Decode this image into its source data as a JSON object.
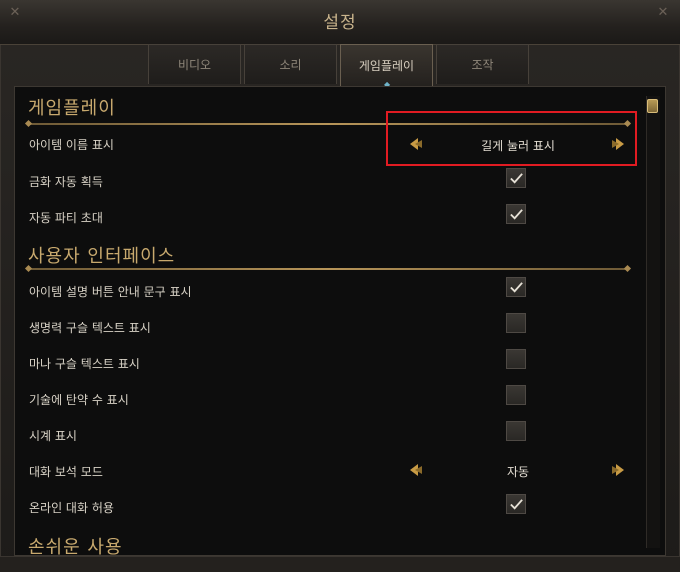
{
  "window": {
    "title": "설정"
  },
  "tabs": [
    {
      "label": "비디오",
      "active": false
    },
    {
      "label": "소리",
      "active": false
    },
    {
      "label": "게임플레이",
      "active": true
    },
    {
      "label": "조작",
      "active": false
    }
  ],
  "sections": {
    "gameplay": "게임플레이",
    "ui": "사용자 인터페이스",
    "accessibility": "손쉬운 사용"
  },
  "settings": {
    "item_name_display": {
      "label": "아이템 이름 표시",
      "value": "길게 눌러 표시"
    },
    "gold_autopickup": {
      "label": "금화 자동 획득",
      "checked": true
    },
    "auto_party_invite": {
      "label": "자동 파티 초대",
      "checked": true
    },
    "item_tooltip_hint": {
      "label": "아이템 설명 버튼 안내 문구 표시",
      "checked": true
    },
    "life_orb_text": {
      "label": "생명력 구슬 텍스트 표시",
      "checked": false
    },
    "mana_orb_text": {
      "label": "마나 구슬 텍스트 표시",
      "checked": false
    },
    "skill_charges": {
      "label": "기술에 탄약 수 표시",
      "checked": false
    },
    "clock": {
      "label": "시계 표시",
      "checked": false
    },
    "chat_gem_mode": {
      "label": "대화 보석 모드",
      "value": "자동"
    },
    "online_chat": {
      "label": "온라인 대화 허용",
      "checked": true
    }
  },
  "colors": {
    "accent_gold": "#c8a96e",
    "highlight_red": "#e11b22",
    "check_color": "#e6e1d6"
  },
  "icons": {
    "arrow_left": "arrow-left-icon",
    "arrow_right": "arrow-right-icon",
    "check": "checkmark-icon"
  }
}
